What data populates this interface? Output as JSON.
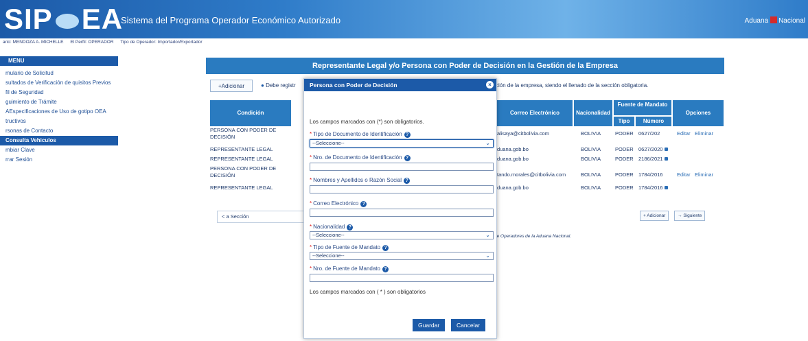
{
  "header": {
    "logo_left": "SIP",
    "logo_right": "EA",
    "title": "Sistema del Programa Operador Económico Autorizado",
    "right_text": "Aduana",
    "right_text2": "Nacional"
  },
  "userbar": {
    "user": "ario: MENDOZA A. MICHELLE",
    "profile": "El Perfil: OPERADOR",
    "operator_type": "Tipo de Operador: Importador/Exportador"
  },
  "sidebar": {
    "head": "MENU",
    "items": [
      {
        "label": "mulario de Solicitud"
      },
      {
        "label": "sultados de Verificación de quisitos Previos"
      },
      {
        "label": "fil de Seguridad"
      },
      {
        "label": "guimiento de Trámite"
      },
      {
        "label": "AEspecificaciones de Uso de gotipo OEA"
      },
      {
        "label": "tructivos"
      },
      {
        "label": "rsonas de Contacto"
      },
      {
        "label": "Consulta Vehiculos"
      },
      {
        "label": "mbiar Clave"
      },
      {
        "label": "rrar Sesión"
      }
    ]
  },
  "panel": {
    "title": "Representante Legal y/o Persona con Poder de Decisión en la Gestión de la Empresa",
    "add_button": "+Adicionar",
    "info_prefix": "Debe registr",
    "info_suffix": "ción de la empresa, siendo el llenado de la sección obligatoria.",
    "columns": {
      "condicion": "Condición",
      "correo": "Correo Electrónico",
      "nacionalidad": "Nacionalidad",
      "fuente": "Fuente de Mandato",
      "tipo": "Tipo",
      "numero": "Número",
      "opciones": "Opciones"
    },
    "rows": [
      {
        "condicion": "PERSONA CON PODER DE DECISIÓN",
        "correo": "alisaya@citbolivia.com",
        "nac": "BOLIVIA",
        "tipo": "PODER",
        "numero": "0627/202",
        "editar": "Editar",
        "eliminar": "Eliminar"
      },
      {
        "condicion": "REPRESENTANTE LEGAL",
        "correo": "duana.gob.bo",
        "nac": "BOLIVIA",
        "tipo": "PODER",
        "numero": "0627/2020"
      },
      {
        "condicion": "REPRESENTANTE LEGAL",
        "correo": "duana.gob.bo",
        "nac": "BOLIVIA",
        "tipo": "PODER",
        "numero": "2186/2021"
      },
      {
        "condicion": "PERSONA CON PODER DE DECISIÓN",
        "correo": "tando.morales@citbolivia.com",
        "nac": "BOLIVIA",
        "tipo": "PODER",
        "numero": "1784/2016",
        "editar": "Editar",
        "eliminar": "Eliminar"
      },
      {
        "condicion": "REPRESENTANTE LEGAL",
        "correo": "duana.gob.bo",
        "nac": "BOLIVIA",
        "tipo": "PODER",
        "numero": "1784/2016"
      }
    ],
    "section_button": "a Sección",
    "add_button_bottom": "Adicionar",
    "next_button": "Siguiente",
    "footnote": "de Operadores de la Aduana Nacional."
  },
  "modal": {
    "title": "Persona con Poder de Decisión",
    "close": "×",
    "note_top": "Los campos marcados con (*) son obligatorios.",
    "fields": {
      "tipo_doc": {
        "label": "Tipo de Documento de Identificación",
        "value": "--Seleccione--"
      },
      "nro_doc": {
        "label": "Nro. de Documento de Identificación",
        "value": ""
      },
      "nombres": {
        "label": "Nombres y Apellidos o Razón Social",
        "value": ""
      },
      "correo": {
        "label": "Correo Electrónico",
        "value": ""
      },
      "nacionalidad": {
        "label": "Nacionalidad",
        "value": "--Seleccione--"
      },
      "tipo_fuente": {
        "label": "Tipo de Fuente de Mandato",
        "value": "--Seleccione--"
      },
      "nro_fuente": {
        "label": "Nro. de Fuente de Mandato",
        "value": ""
      }
    },
    "note_bottom": "Los campos marcados con ( * ) son obligatorios",
    "save": "Guardar",
    "cancel": "Cancelar"
  }
}
